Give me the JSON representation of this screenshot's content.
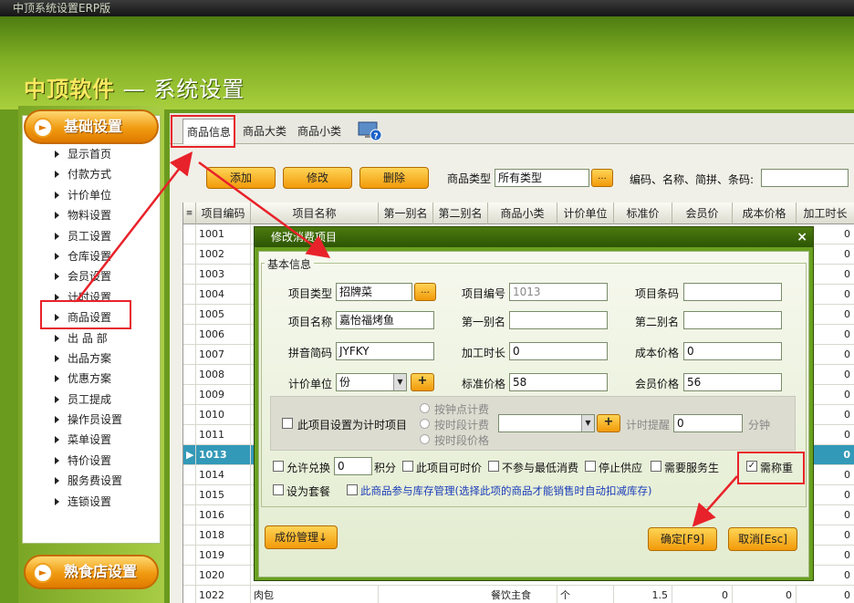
{
  "window": {
    "title": "中顶系统设置ERP版"
  },
  "header": {
    "brand": "中顶软件",
    "dash": " — ",
    "subtitle": "系统设置"
  },
  "sidebar": {
    "section1": "基础设置",
    "section2": "熟食店设置",
    "items": [
      "显示首页",
      "付款方式",
      "计价单位",
      "物料设置",
      "员工设置",
      "仓库设置",
      "会员设置",
      "计时设置",
      "商品设置",
      "出 品 部",
      "出品方案",
      "优惠方案",
      "员工提成",
      "操作员设置",
      "菜单设置",
      "特价设置",
      "服务费设置",
      "连锁设置"
    ]
  },
  "tabs": [
    "商品信息",
    "商品大类",
    "商品小类"
  ],
  "toolbar": {
    "add": "添加",
    "edit": "修改",
    "delete": "删除",
    "type_label": "商品类型",
    "type_value": "所有类型",
    "dots": "...",
    "search_label": "编码、名称、简拼、条码:"
  },
  "grid": {
    "columns": [
      "项目编码",
      "项目名称",
      "第一别名",
      "第二别名",
      "商品小类",
      "计价单位",
      "标准价",
      "会员价",
      "成本价格",
      "加工时长"
    ],
    "rows": [
      {
        "code": "1001",
        "last": "0"
      },
      {
        "code": "1002",
        "last": "0"
      },
      {
        "code": "1003",
        "last": "0"
      },
      {
        "code": "1004",
        "last": "0"
      },
      {
        "code": "1005",
        "last": "0"
      },
      {
        "code": "1006",
        "last": "0"
      },
      {
        "code": "1007",
        "last": "0"
      },
      {
        "code": "1008",
        "last": "0"
      },
      {
        "code": "1009",
        "last": "0"
      },
      {
        "code": "1010",
        "last": "0"
      },
      {
        "code": "1011",
        "last": "0"
      },
      {
        "code": "1013",
        "last": "0"
      },
      {
        "code": "1014",
        "last": "0"
      },
      {
        "code": "1015",
        "last": "0"
      },
      {
        "code": "1016",
        "last": "0"
      },
      {
        "code": "1018",
        "last": "0"
      },
      {
        "code": "1019",
        "last": "0"
      },
      {
        "code": "1020",
        "last": "0"
      }
    ],
    "last_row": {
      "code": "1022",
      "name": "肉包",
      "subtype": "餐饮主食",
      "unit": "个",
      "price": "1.5",
      "member": "0",
      "cost": "0",
      "time": "0"
    }
  },
  "dialog": {
    "title": "修改消费项目",
    "close": "×",
    "group": "基本信息",
    "item_type_label": "项目类型",
    "item_type": "招牌菜",
    "item_code_label": "项目编号",
    "item_code": "1013",
    "barcode_label": "项目条码",
    "barcode": "",
    "name_label": "项目名称",
    "name": "嘉怡福烤鱼",
    "alias1_label": "第一别名",
    "alias1": "",
    "alias2_label": "第二别名",
    "alias2": "",
    "pinyin_label": "拼音简码",
    "pinyin": "JYFKY",
    "proc_label": "加工时长",
    "proc": "0",
    "cost_label": "成本价格",
    "cost": "0",
    "unit_label": "计价单位",
    "unit": "份",
    "std_label": "标准价格",
    "std": "58",
    "member_label": "会员价格",
    "member": "56",
    "timed_label": "此项目设置为计时项目",
    "radio1": "按钟点计费",
    "radio2": "按时段计费",
    "radio3": "按时段价格",
    "remind_label": "计时提醒",
    "remind": "0",
    "minutes": "分钟",
    "exchange_label": "允许兑换",
    "exchange": "0",
    "points": "积分",
    "timeprice_label": "此项目可时价",
    "nomin_label": "不参与最低消费",
    "stop_label": "停止供应",
    "service_label": "需要服务生",
    "weigh_label": "需称重",
    "combo_label": "设为套餐",
    "stock_label": "此商品参与库存管理(选择此项的商品才能销售时自动扣减库存)",
    "portion_btn": "成份管理↓",
    "ok_btn": "确定[F9]",
    "cancel_btn": "取消[Esc]"
  },
  "colors": {
    "accent": "#f29a0a",
    "highlight": "#e8222a",
    "selected_row": "#3399b8",
    "header_green": "#7fae24"
  }
}
